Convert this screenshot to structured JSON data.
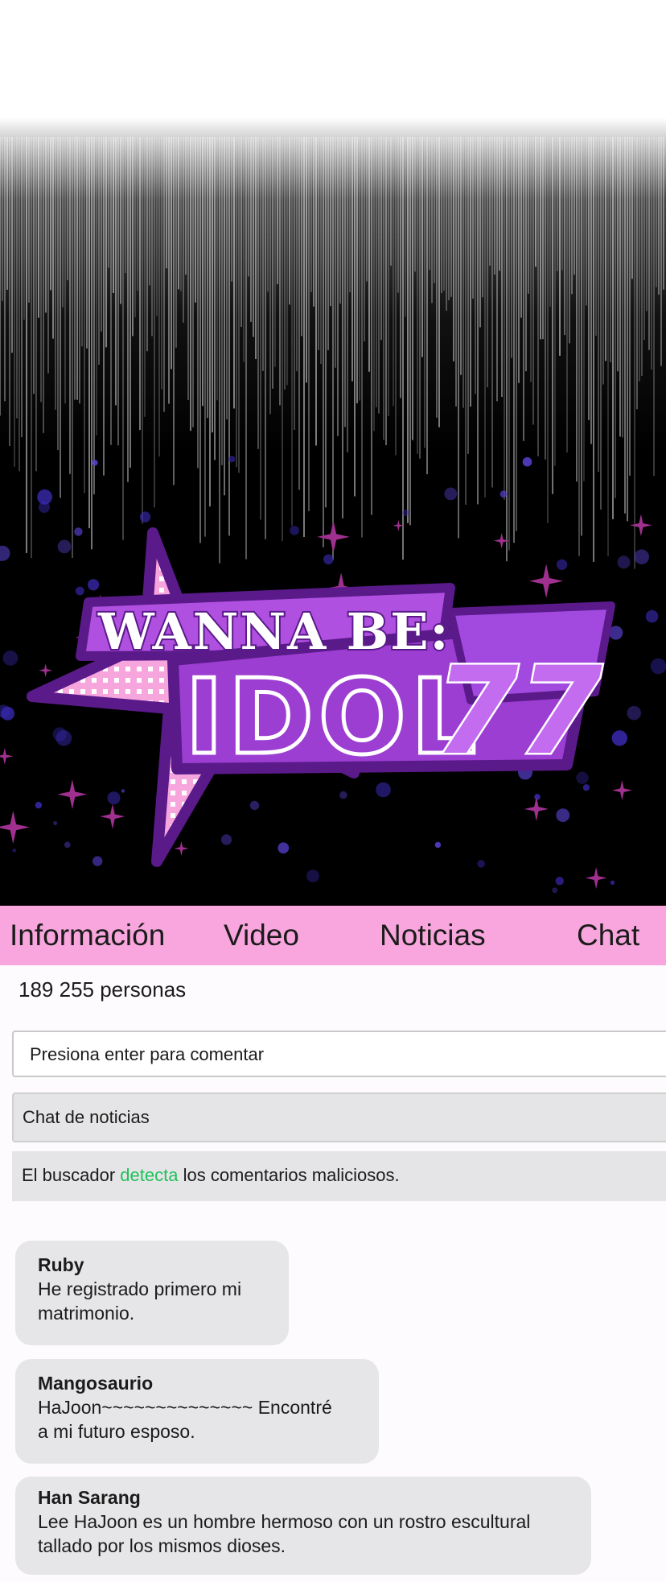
{
  "banner": {
    "logo_top": "WANNA BE:",
    "logo_main": "IDOL",
    "logo_number": "77"
  },
  "tabs": [
    {
      "label": "Información"
    },
    {
      "label": "Video"
    },
    {
      "label": "Noticias"
    },
    {
      "label": "Chat"
    }
  ],
  "viewers": "189 255 personas",
  "comment_input": {
    "placeholder": "Presiona enter para comentar"
  },
  "news_chat": {
    "label": "Chat de noticias"
  },
  "notice": {
    "before": "El buscador ",
    "highlight": "detecta",
    "after": " los comentarios maliciosos."
  },
  "messages": [
    {
      "name": "Ruby",
      "text": "He registrado primero mi\nmatrimonio."
    },
    {
      "name": "Mangosaurio",
      "text": "HaJoon~~~~~~~~~~~~~~ Encontré\n a  mi futuro esposo."
    },
    {
      "name": "Han Sarang",
      "text": "Lee HaJoon es un hombre hermoso con un rostro escultural\ntallado por los mismos dioses."
    }
  ],
  "colors": {
    "tab_bar": "#f8a6dd",
    "bubble": "#e6e5e8",
    "highlight": "#1fc25a",
    "logo_purple": "#9b3ed1",
    "logo_pink": "#f7a6dd"
  }
}
